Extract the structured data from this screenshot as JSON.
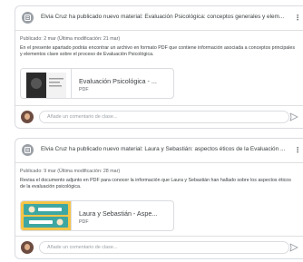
{
  "posts": [
    {
      "title": "Elvia Cruz ha publicado nuevo material: Evaluación Psicológica: conceptos generales y elem...",
      "posted": "Publicado: 2 mar (Última modificación: 21 mar)",
      "description": "En el presente apartado podrás encontrar un archivo en formato PDF que contiene información asociada a conceptos principales y elementos clave sobre el proceso de Evaluación Psicológica.",
      "attachment_title": "Evaluación Psicológica - ...",
      "attachment_type": "PDF",
      "comment_placeholder": "Añade un comentario de clase..."
    },
    {
      "title": "Elvia Cruz ha publicado nuevo material: Laura y Sebastián: aspectos éticos de la Evaluación ...",
      "posted": "Publicado: 9 mar (Última modificación: 28 mar)",
      "description": "Revisa el documento adjunto en PDF para conocer la información que Laura y Sebastián han hallado sobre los aspectos éticos de la evaluación psicológica.",
      "attachment_title": "Laura y Sebastián - Aspe...",
      "attachment_type": "PDF",
      "comment_placeholder": "Añade un comentario de clase..."
    }
  ],
  "icons": {
    "post_type": "material-icon",
    "more": "more-vert-icon",
    "send": "send-icon"
  },
  "colors": {
    "icon_gray": "#9aa0a6",
    "border": "#dadce0",
    "text": "#3c4043",
    "thumb_teal": "#3fa7a2",
    "thumb_yellow": "#f6c548"
  }
}
